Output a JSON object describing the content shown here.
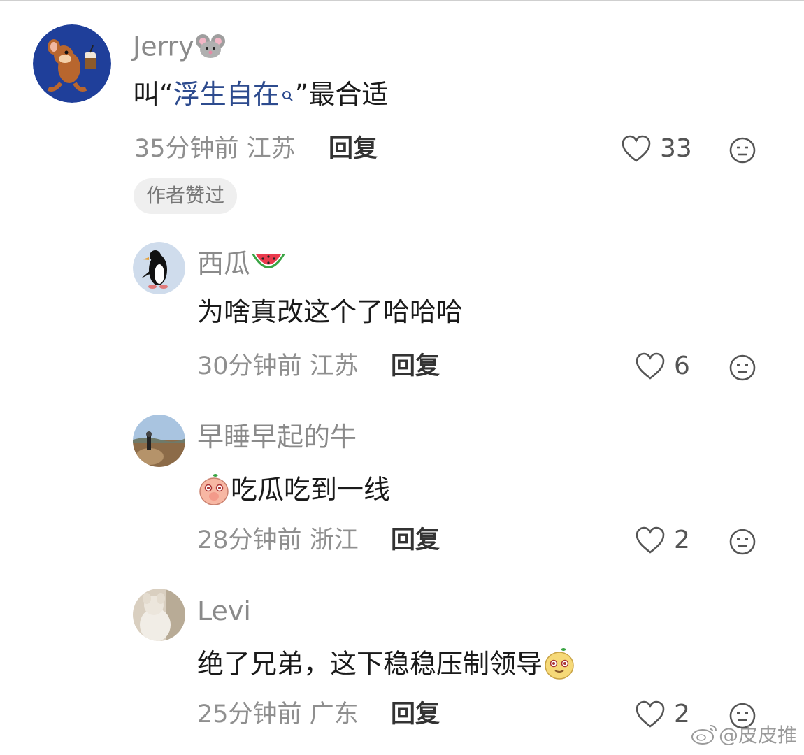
{
  "comments": [
    {
      "username": "Jerry",
      "username_emoji": "mouse-emoji",
      "text_prefix": "叫“",
      "text_link": "浮生自在",
      "text_suffix": "”最合适",
      "time": "35分钟前",
      "location": "江苏",
      "reply_label": "回复",
      "likes": "33",
      "badge": "作者赞过"
    },
    {
      "username": "西瓜",
      "username_emoji": "watermelon-emoji",
      "text": "为啥真改这个了哈哈哈",
      "time": "30分钟前",
      "location": "江苏",
      "reply_label": "回复",
      "likes": "6"
    },
    {
      "username": "早睡早起的牛",
      "text_emoji": "peach-face-emoji",
      "text": "吃瓜吃到一线",
      "time": "28分钟前",
      "location": "浙江",
      "reply_label": "回复",
      "likes": "2"
    },
    {
      "username": "Levi",
      "text": "绝了兄弟，这下稳稳压制领导",
      "text_emoji": "yellow-face-emoji",
      "time": "25分钟前",
      "location": "广东",
      "reply_label": "回复",
      "likes": "2"
    }
  ],
  "watermark": "@皮皮推",
  "colors": {
    "link": "#2d4b8e",
    "meta": "#8f8f8f",
    "name": "#8a8a8a",
    "badge_bg": "#efefef"
  }
}
